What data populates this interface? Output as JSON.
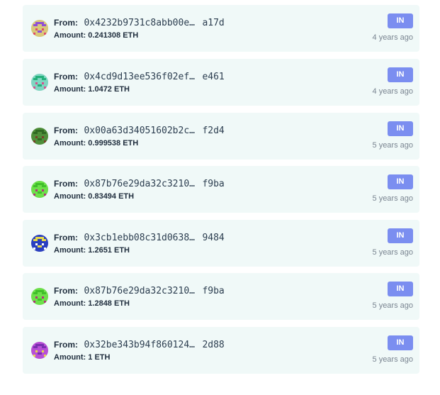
{
  "transactions": [
    {
      "from_label": "From:",
      "address_head": "0x4232b9731c8abb00e…",
      "address_tail": "a17d",
      "amount_label": "Amount:",
      "amount": "0.241308 ETH",
      "direction": "IN",
      "time": "4 years ago",
      "avatar": {
        "bg": "#d9c97a",
        "fg": "#8f4fd6",
        "accent": "#e04a6a"
      }
    },
    {
      "from_label": "From:",
      "address_head": "0x4cd9d13ee536f02ef…",
      "address_tail": "e461",
      "amount_label": "Amount:",
      "amount": "1.0472 ETH",
      "direction": "IN",
      "time": "4 years ago",
      "avatar": {
        "bg": "#7fd6c2",
        "fg": "#23b07a",
        "accent": "#d64f8f"
      }
    },
    {
      "from_label": "From:",
      "address_head": "0x00a63d34051602b2c…",
      "address_tail": "f2d4",
      "amount_label": "Amount:",
      "amount": "0.999538 ETH",
      "direction": "IN",
      "time": "5 years ago",
      "avatar": {
        "bg": "#4f8f3a",
        "fg": "#2f6a22",
        "accent": "#7a3f2a"
      }
    },
    {
      "from_label": "From:",
      "address_head": "0x87b76e29da32c3210…",
      "address_tail": "f9ba",
      "amount_label": "Amount:",
      "amount": "0.83494 ETH",
      "direction": "IN",
      "time": "5 years ago",
      "avatar": {
        "bg": "#6de04a",
        "fg": "#3fbf2a",
        "accent": "#b0327a"
      }
    },
    {
      "from_label": "From:",
      "address_head": "0x3cb1ebb08c31d0638…",
      "address_tail": "9484",
      "amount_label": "Amount:",
      "amount": "1.2651 ETH",
      "direction": "IN",
      "time": "5 years ago",
      "avatar": {
        "bg": "#2a3fc0",
        "fg": "#e6d84a",
        "accent": "#ffffff"
      }
    },
    {
      "from_label": "From:",
      "address_head": "0x87b76e29da32c3210…",
      "address_tail": "f9ba",
      "amount_label": "Amount:",
      "amount": "1.2848 ETH",
      "direction": "IN",
      "time": "5 years ago",
      "avatar": {
        "bg": "#6de04a",
        "fg": "#3fbf2a",
        "accent": "#b0327a"
      }
    },
    {
      "from_label": "From:",
      "address_head": "0x32be343b94f860124…",
      "address_tail": "2d88",
      "amount_label": "Amount:",
      "amount": "1 ETH",
      "direction": "IN",
      "time": "5 years ago",
      "avatar": {
        "bg": "#b84fd6",
        "fg": "#7a2fb0",
        "accent": "#e6d84a"
      }
    }
  ],
  "colors": {
    "row_bg": "#f0f9f8",
    "badge_bg": "#7b8ef0",
    "badge_text": "#ffffff",
    "time_text": "#7a8591"
  }
}
